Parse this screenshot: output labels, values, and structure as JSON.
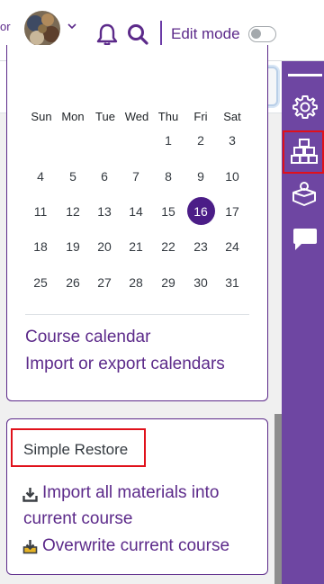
{
  "navbar": {
    "prev_text": "or",
    "edit_mode_label": "Edit mode",
    "edit_mode_on": false
  },
  "drawer": {
    "close_label": "×"
  },
  "calendar": {
    "weekdays": [
      "Sun",
      "Mon",
      "Tue",
      "Wed",
      "Thu",
      "Fri",
      "Sat"
    ],
    "weeks": [
      [
        "",
        "",
        "",
        "",
        "1",
        "2",
        "3"
      ],
      [
        "4",
        "5",
        "6",
        "7",
        "8",
        "9",
        "10"
      ],
      [
        "11",
        "12",
        "13",
        "14",
        "15",
        "16",
        "17"
      ],
      [
        "18",
        "19",
        "20",
        "21",
        "22",
        "23",
        "24"
      ],
      [
        "25",
        "26",
        "27",
        "28",
        "29",
        "30",
        "31"
      ]
    ],
    "today": "16",
    "links": [
      "Course calendar",
      "Import or export calendars"
    ]
  },
  "restore": {
    "title": "Simple Restore",
    "link1_line1": "Import all materials into",
    "link1_line2": "current course",
    "link2": "Overwrite current course"
  },
  "colors": {
    "brand": "#5c2a8a",
    "rail": "#6e46a2",
    "today": "#4b1d87",
    "highlight": "#e0111b"
  },
  "icons": {
    "rail": [
      "gear-icon",
      "blocks-icon",
      "person-box-icon",
      "chat-icon"
    ]
  }
}
